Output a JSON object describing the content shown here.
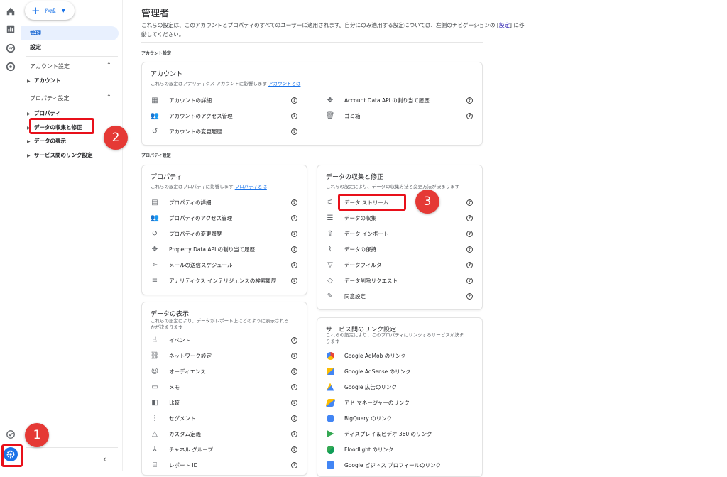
{
  "rail": {
    "icons": [
      "home-icon",
      "reports-icon",
      "explore-icon",
      "advertising-icon",
      "check-icon",
      "admin-gear-icon"
    ]
  },
  "nav": {
    "create_label": "作成",
    "admin_label": "管理",
    "settings_label": "設定",
    "account_section": "アカウント設定",
    "account_item": "アカウント",
    "property_section": "プロパティ設定",
    "property_items": [
      "プロパティ",
      "データの収集と修正",
      "データの表示",
      "サービス間のリンク設定"
    ]
  },
  "badges": [
    "1",
    "2",
    "3"
  ],
  "main": {
    "title": "管理者",
    "intro_pre": "これらの設定は、このアカウントとプロパティのすべてのユーザーに適用されます。自分にのみ適用する設定については、左側のナビゲーションの [",
    "intro_link": "設定",
    "intro_post": "] に移動してください。",
    "account_group": "アカウント設定",
    "property_group": "プロパティ設定"
  },
  "account_card": {
    "title": "アカウント",
    "sub": "これらの設定はアナリティクス アカウントに影響します",
    "link": "アカウントとは",
    "left": [
      "アカウントの詳細",
      "アカウントのアクセス管理",
      "アカウントの変更履歴"
    ],
    "right": [
      "Account Data API の割り当て履歴",
      "ゴミ箱"
    ]
  },
  "property_card": {
    "title": "プロパティ",
    "sub": "これらの設定はプロパティに影響します",
    "link": "プロパティとは",
    "items": [
      "プロパティの詳細",
      "プロパティのアクセス管理",
      "プロパティの変更履歴",
      "Property Data API の割り当て履歴",
      "メールの送信スケジュール",
      "アナリティクス インテリジェンスの検索履歴"
    ]
  },
  "collection_card": {
    "title": "データの収集と修正",
    "sub": "これらの設定により、データの収集方法と変更方法が決まります",
    "items": [
      "データ ストリーム",
      "データの収集",
      "データ インポート",
      "データの保持",
      "データフィルタ",
      "データ削除リクエスト",
      "同意設定"
    ]
  },
  "display_card": {
    "title": "データの表示",
    "sub1": "これらの設定により、データがレポート上にどのように表示される",
    "sub2": "かが決まります",
    "items": [
      "イベント",
      "ネットワーク設定",
      "オーディエンス",
      "メモ",
      "比較",
      "セグメント",
      "カスタム定義",
      "チャネル グループ",
      "レポート ID"
    ]
  },
  "link_card": {
    "title": "サービス間のリンク設定",
    "sub1": "これらの設定により、このプロパティにリンクするサービスが決ま",
    "sub2": "ります",
    "items": [
      "Google AdMob のリンク",
      "Google AdSense のリンク",
      "Google 広告のリンク",
      "アド マネージャーのリンク",
      "BigQuery のリンク",
      "ディスプレイ＆ビデオ 360 のリンク",
      "Floodlight のリンク",
      "Google ビジネス プロフィールのリンク"
    ],
    "colors": [
      "#ea4335",
      "#fbbc04",
      "#4285f4",
      "#34a853",
      "#4285f4",
      "#34a853",
      "#34a853",
      "#4285f4"
    ]
  },
  "help_glyph": "?"
}
